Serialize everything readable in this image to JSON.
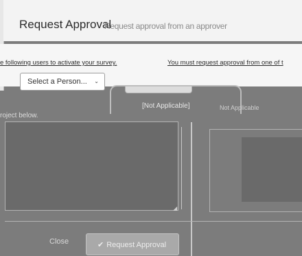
{
  "dialog": {
    "title": "Request Approval",
    "title_ghost": "Request approval from an approver"
  },
  "instructions": {
    "line_left": "e following users to activate your survey.",
    "line_right": "You must request approval from one of t"
  },
  "approver_select": {
    "value": "Select a Person...",
    "chevron": "⌄"
  },
  "selection": {
    "label": "[Not Applicable]",
    "secondary": "Not Applicable"
  },
  "project": {
    "text": "roject below."
  },
  "footer": {
    "close_label": "Close",
    "request_label": "Request Approval",
    "request_icon": "check-icon"
  },
  "colors": {
    "overlay": "#7c7c7c",
    "header_bg": "#f3f3f3",
    "strip_pink": "#d98be0",
    "strip_cyan": "#3dd4e2",
    "strip_blue": "#1d4fd6"
  }
}
